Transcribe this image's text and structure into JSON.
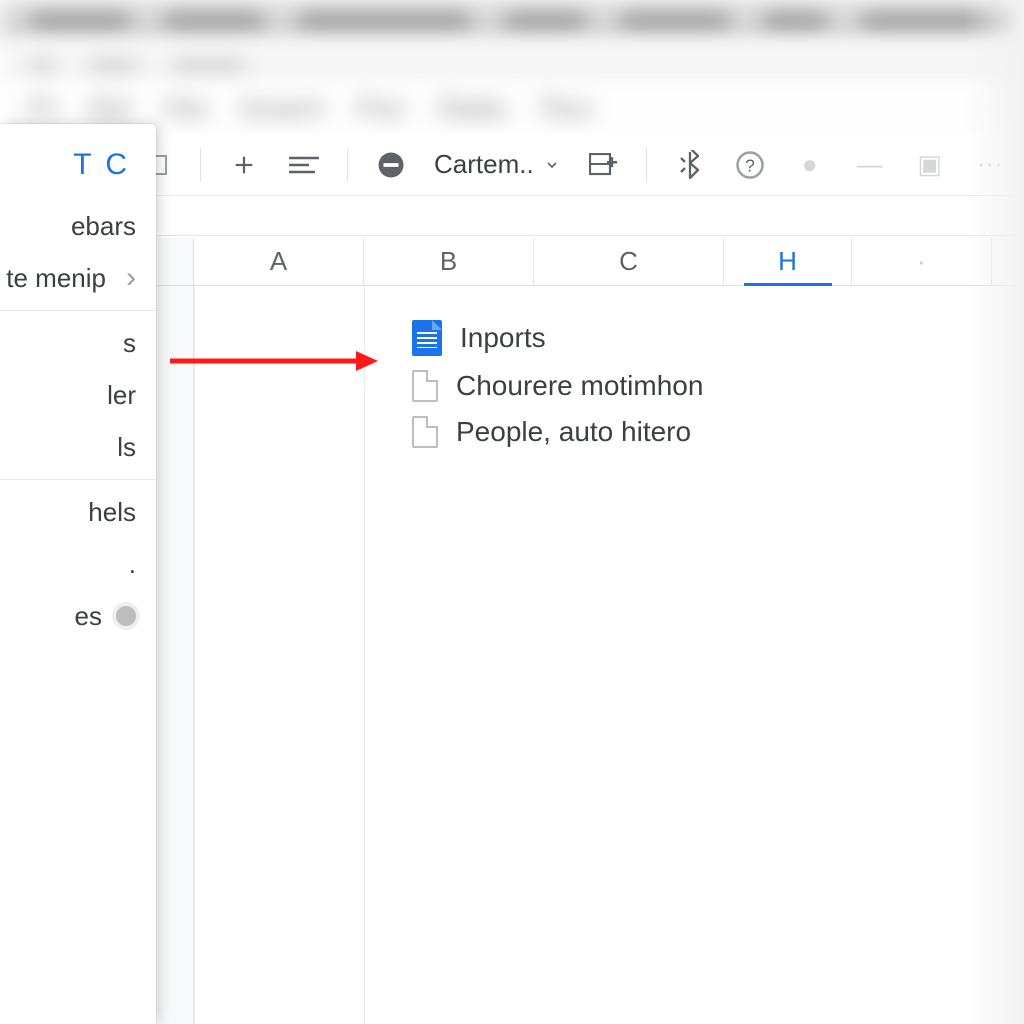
{
  "toolbar": {
    "font_label": "Cartem.."
  },
  "columns": {
    "A": "A",
    "B": "B",
    "C": "C",
    "H": "H"
  },
  "panel": {
    "header": "T C",
    "items": {
      "ebars": "ebars",
      "submenu": "te menip",
      "s": "s",
      "ler": "ler",
      "ls": "ls",
      "hels": "hels",
      "dot": ".",
      "es": "es"
    }
  },
  "popover": {
    "doc": "Inports",
    "file1": "Chourere motimhon",
    "file2": "People, auto hitero"
  }
}
